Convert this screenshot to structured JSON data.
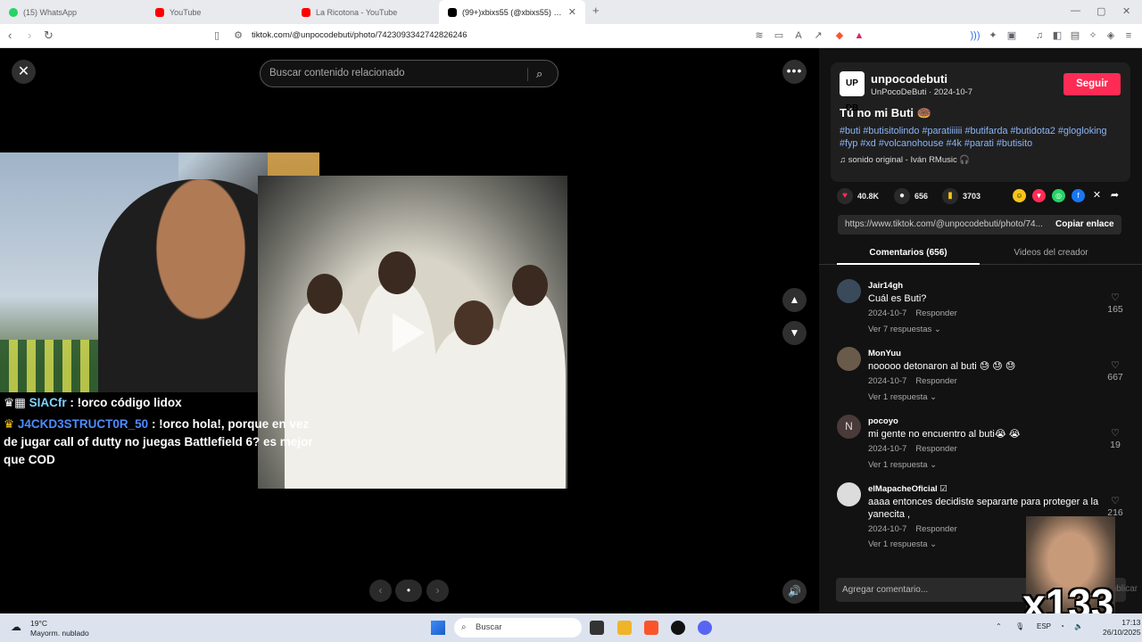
{
  "browser": {
    "tabs": [
      {
        "title": "(15) WhatsApp",
        "color": "#25d366"
      },
      {
        "title": "YouTube",
        "color": "#ff0000"
      },
      {
        "title": "La Ricotona - YouTube",
        "color": "#ff0000"
      },
      {
        "title": "(99+)xbixs55 (@xbixs55) | TikTok",
        "color": "#000000",
        "active": true
      }
    ],
    "url": "tiktok.com/@unpocodebuti/photo/7423093342742826246"
  },
  "viewer": {
    "search_placeholder": "Buscar contenido relacionado",
    "chat": [
      {
        "user": "SIACfr",
        "message": ": !orco código lidox"
      },
      {
        "user": "J4CKD3STRUCT0R_50",
        "message": ": !orco hola!, porque en vez de jugar call of dutty no juegas Battlefield 6? es mejor que COD"
      }
    ],
    "pager": {
      "prev": "‹",
      "dot": "•",
      "next": "›"
    }
  },
  "post": {
    "author": "unpocodebuti",
    "author_display": "UnPocoDeButi · 2024-10-7",
    "avatar_text": "UP DB",
    "follow_label": "Seguir",
    "title": "Tú no mi Buti 🍩",
    "hashtags": "#buti #butisitolindo #paratiiiiii #butifarda #butidota2 #glogloking #fyp #xd #volcanohouse #4k #parati #butisito",
    "sound": "♫  sonido original - Iván RMusic 🎧",
    "likes": "40.8K",
    "comments": "656",
    "saves": "3703",
    "share_link": "https://www.tiktok.com/@unpocodebuti/photo/74...",
    "copy_label": "Copiar enlace",
    "accent": "#fe2c55"
  },
  "panel_tabs": {
    "comments_tab": "Comentarios (656)",
    "creator_tab": "Videos del creador"
  },
  "comments": [
    {
      "user": "Jair14gh",
      "text": "Cuál es Buti?",
      "date": "2024-10-7",
      "reply": "Responder",
      "replies": "Ver 7 respuestas ⌄",
      "likes": "165",
      "avatar": ""
    },
    {
      "user": "MonYuu",
      "text": "nooooo detonaron al buti 😓 😓 😓",
      "date": "2024-10-7",
      "reply": "Responder",
      "replies": "Ver 1 respuesta ⌄",
      "likes": "667",
      "avatar": ""
    },
    {
      "user": "pocoyo",
      "text": "mi gente no encuentro al buti😭 😭",
      "date": "2024-10-7",
      "reply": "Responder",
      "replies": "Ver 1 respuesta ⌄",
      "likes": "19",
      "avatar": "N"
    },
    {
      "user": "elMapacheOficial ☑",
      "text": "aaaa entonces decidiste separarte para proteger a la yanecita ,",
      "date": "2024-10-7",
      "reply": "Responder",
      "replies": "Ver 1 respuesta ⌄",
      "likes": "216",
      "avatar": ""
    }
  ],
  "add_comment_placeholder": "Agregar comentario...",
  "publish_label": "Publicar",
  "overlay_counter": "x133",
  "taskbar": {
    "weather_temp": "19°C",
    "weather_cond": "Mayorm. nublado",
    "search": "Buscar",
    "lang": "ESP",
    "time": "17:13",
    "date": "26/10/2025"
  }
}
